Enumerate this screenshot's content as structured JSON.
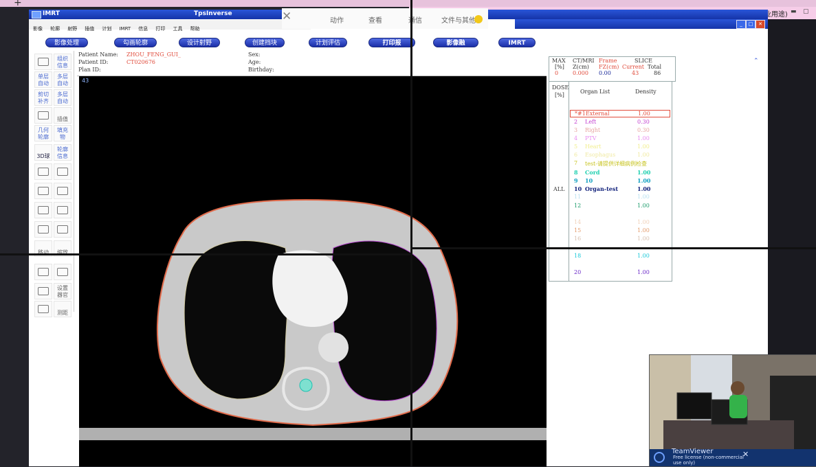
{
  "top": {
    "plus": "+",
    "license": "免费许可证(仅非商业用途)"
  },
  "app": {
    "name": "IMRT",
    "title": "TpsInverse"
  },
  "menu": [
    "影像",
    "轮廓",
    "射野",
    "插值",
    "计划",
    "IMRT",
    "信息",
    "打印",
    "工具",
    "帮助"
  ],
  "remote_toolbar": {
    "close": "✕",
    "items": [
      "动作",
      "查看",
      "通信",
      "文件与其他"
    ]
  },
  "window_buttons": [
    "_",
    "□",
    "✕"
  ],
  "modes": [
    "影像处理",
    "勾画轮廓",
    "设计射野",
    "创建挡块",
    "计划评估",
    "打印报告/3D",
    "影像融合/4D",
    "IMRT"
  ],
  "patient": {
    "name_label": "Patient Name:",
    "name": "ZHOU_FENG_GUI_",
    "id_label": "Patient ID:",
    "id": "CT020676",
    "plan_label": "Plan ID:",
    "sex_label": "Sex:",
    "age_label": "Age:",
    "birthday_label": "Birthday:"
  },
  "tools": [
    {
      "top": "",
      "bottom": ""
    },
    {
      "top": "组织",
      "bottom": "信息"
    },
    {
      "top": "单层",
      "bottom": "自动"
    },
    {
      "top": "多层",
      "bottom": "自动"
    },
    {
      "top": "剪切",
      "bottom": "补齐"
    },
    {
      "top": "多层",
      "bottom": "自动"
    },
    {
      "top": "",
      "bottom": ""
    },
    {
      "top": "插值",
      "bottom": ""
    },
    {
      "top": "几何",
      "bottom": "轮廓"
    },
    {
      "top": "填充",
      "bottom": "物"
    },
    {
      "top": "3D球",
      "bottom": ""
    },
    {
      "top": "轮廓",
      "bottom": "信息"
    },
    {
      "top": "移动",
      "bottom": ""
    },
    {
      "top": "缩放",
      "bottom": ""
    },
    {
      "top": "设置",
      "bottom": "器官"
    },
    {
      "top": "测距",
      "bottom": ""
    }
  ],
  "viewer": {
    "slice": "43"
  },
  "info": {
    "max_label": "MAX",
    "max_unit": "[%]",
    "max_value": "0",
    "ctmri_label": "CT/MRI",
    "zcm_label": "Z(cm)",
    "z_value": "0.000",
    "frame_label": "Frame",
    "fz_label": "FZ(cm)",
    "fz_value": "0.00",
    "slice_label": "SLICE",
    "current_label": "Current",
    "current_value": "43",
    "total_label": "Total",
    "total_value": "86"
  },
  "organ_panel": {
    "dose_label": "DOSE",
    "dose_unit": "[%]",
    "all_label": "ALL",
    "header_list": "Organ List",
    "header_density": "Density",
    "organs": [
      {
        "num": "*#1",
        "name": "External",
        "density": "1.00",
        "color": "#e24b3a"
      },
      {
        "num": "2",
        "name": "Left",
        "density": "0.30",
        "color": "#c23fd0"
      },
      {
        "num": "3",
        "name": "Right",
        "density": "0.30",
        "color": "#e7a3a0"
      },
      {
        "num": "4",
        "name": "PTV",
        "density": "1.00",
        "color": "#e88bf0"
      },
      {
        "num": "5",
        "name": "Heart",
        "density": "1.00",
        "color": "#f1ee8c"
      },
      {
        "num": "6",
        "name": "Esophagus",
        "density": "1.00",
        "color": "#f0e9a0"
      },
      {
        "num": "7",
        "name": "test-请提供详细病例检查",
        "density": "",
        "color": "#c6c21a"
      },
      {
        "num": "8",
        "name": "Cord",
        "density": "1.00",
        "color": "#1fd0b0"
      },
      {
        "num": "9",
        "name": "10",
        "density": "1.00",
        "color": "#10a0c0"
      },
      {
        "num": "10",
        "name": "Organ-test",
        "density": "1.00",
        "color": "#0f1f7a"
      },
      {
        "num": "11",
        "name": "",
        "density": "1.00",
        "color": "#b8e0f0"
      },
      {
        "num": "12",
        "name": "",
        "density": "1.00",
        "color": "#1a9b6a"
      },
      {
        "num": "14",
        "name": "",
        "density": "1.00",
        "color": "#f0d0b8"
      },
      {
        "num": "15",
        "name": "",
        "density": "1.00",
        "color": "#e39a6a"
      },
      {
        "num": "16",
        "name": "",
        "density": "1.00",
        "color": "#d8c0b0"
      },
      {
        "num": "18",
        "name": "",
        "density": "1.00",
        "color": "#19c8d8"
      },
      {
        "num": "20",
        "name": "",
        "density": "1.00",
        "color": "#6a28c8"
      }
    ]
  },
  "teamviewer": {
    "title": "TeamViewer",
    "license": "Free license (non-commercial use only)",
    "close": "✕"
  }
}
